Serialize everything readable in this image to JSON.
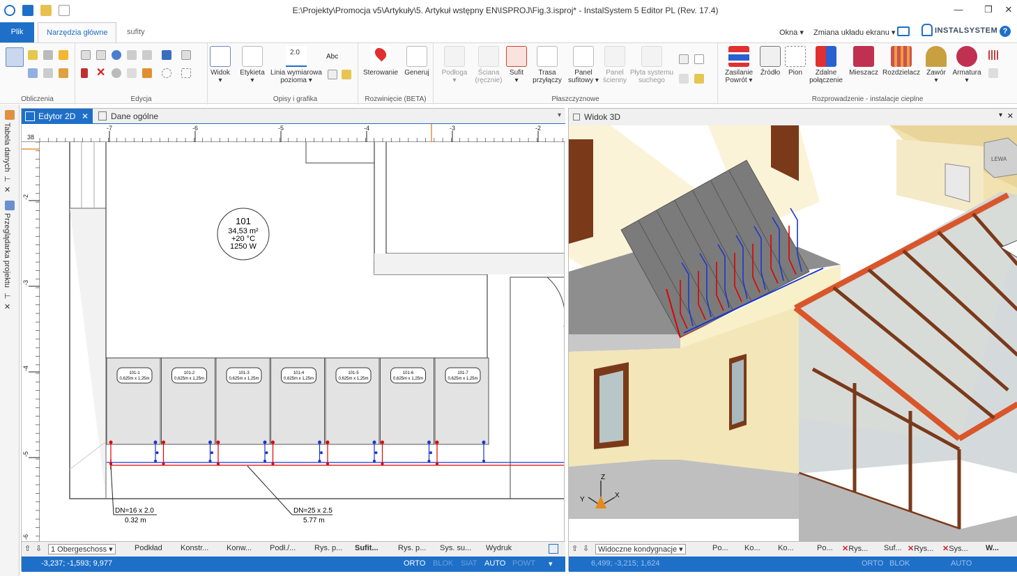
{
  "app": {
    "title": "E:\\Projekty\\Promocja v5\\Artykuły\\5. Artykuł wstępny EN\\ISPROJ\\Fig.3.isproj* - InstalSystem 5 Editor PL (Rev. 17.4)",
    "colors": {
      "accent": "#1e6fc8",
      "hot": "#e00000",
      "cold": "#1a36d0",
      "wall_3d": "#f3e6b8",
      "roof_frame": "#d9562b"
    }
  },
  "ribbon": {
    "tabs": [
      "Plik",
      "Narzędzia główne",
      "sufity"
    ],
    "right": {
      "okna": "Okna",
      "layout": "Zmiana układu ekranu"
    },
    "brand": "INSTALSYSTEM",
    "groups": {
      "obliczenia": "Obliczenia",
      "edycja": "Edycja",
      "opisy": "Opisy i grafika",
      "rozwiniecie": "Rozwinięcie (BETA)",
      "plaszczyznowe": "Płaszczyznowe",
      "rozprowadzenie": "Rozprowadzenie - instalacje cieplne"
    },
    "buttons": {
      "widok": "Widok",
      "etykieta": "Etykieta",
      "linia1": "Linia wymiarowa",
      "linia2": "pozioma",
      "abc": "Abc",
      "dim_value": "2.0",
      "sterowanie": "Sterowanie",
      "generuj": "Generuj",
      "podloga": "Podłoga",
      "sciana1": "Ściana",
      "sciana2": "(ręcznie)",
      "sufit": "Sufit",
      "trasa1": "Trasa",
      "trasa2": "przyłączy",
      "panel1": "Panel",
      "panel2": "sufitowy",
      "panelsc1": "Panel",
      "panelsc2": "ścienny",
      "plyta1": "Płyta systemu",
      "plyta2": "suchego",
      "zasilanie1": "Zasilanie",
      "zasilanie2": "Powrót",
      "zrodlo": "Źródło",
      "pion": "Pion",
      "zdalne1": "Zdalne",
      "zdalne2": "połączenie",
      "mieszacz": "Mieszacz",
      "rozdzielacz": "Rozdzielacz",
      "zawor": "Zawór",
      "armatura": "Armatura"
    }
  },
  "side_panels": [
    "Tabela danych",
    "Przeglądarka projektu"
  ],
  "editor2d": {
    "tabs": [
      "Edytor 2D",
      "Dane ogólne"
    ],
    "ruler_x": [
      "-7",
      "-6",
      "-5",
      "-4",
      "-3",
      "-2"
    ],
    "ruler_y": [
      "-2",
      "-3",
      "-4",
      "-5",
      "-6"
    ],
    "ruler_corner": "38",
    "room": {
      "number": "101",
      "area": "34,53 m²",
      "temp": "+20 °C",
      "power": "1250 W"
    },
    "panels": [
      {
        "id": "101-1",
        "size": "0,625m x 1,25m"
      },
      {
        "id": "101-2",
        "size": "0,625m x 1,25m"
      },
      {
        "id": "101-3",
        "size": "0,625m x 1,25m"
      },
      {
        "id": "101-4",
        "size": "0,625m x 1,25m"
      },
      {
        "id": "101-5",
        "size": "0,625m x 1,25m"
      },
      {
        "id": "101-6",
        "size": "0,625m x 1,25m"
      },
      {
        "id": "101-7",
        "size": "0,625m x 1,25m"
      }
    ],
    "pipe_labels": [
      {
        "dn": "DN=16 x 2.0",
        "len": "0.32 m"
      },
      {
        "dn": "DN=25 x 2.5",
        "len": "5.77 m"
      }
    ],
    "bottom_tabs": [
      "1 Obergeschoss",
      "Podkład",
      "Konstr...",
      "Konw...",
      "Podł./...",
      "Rys. p...",
      "Sufit...",
      "Rys. p...",
      "Sys. su...",
      "Wydruk"
    ],
    "active_bottom_tab": "Sufit...",
    "status": {
      "coords": "-3,237; -1,593; 9,977",
      "orto": "ORTO",
      "blok": "BLOK",
      "siat": "SIAT",
      "auto": "AUTO",
      "powt": "POWT"
    }
  },
  "view3d": {
    "title": "Widok 3D",
    "cube_label": "LEWA",
    "axes": {
      "z": "Z",
      "y": "Y",
      "x": "X"
    },
    "bottom": {
      "kondygnacje": "Widoczne kondygnacje",
      "tabs": [
        "Po...",
        "Ko...",
        "Ko...",
        "Po...",
        "Rys...",
        "Suf...",
        "Rys...",
        "Sys...",
        "W..."
      ]
    },
    "status": {
      "coords": "6,499; -3,215; 1,624",
      "orto": "ORTO",
      "blok": "BLOK",
      "auto": "AUTO"
    }
  }
}
